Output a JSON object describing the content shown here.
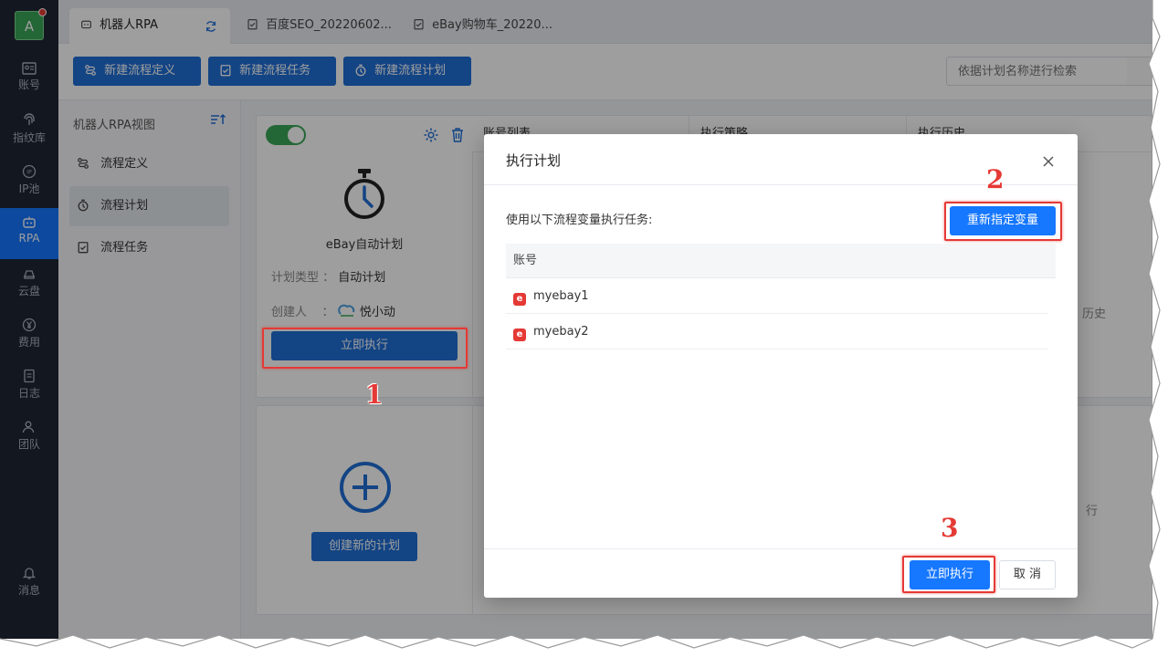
{
  "rail": {
    "avatar_letter": "A",
    "items": [
      {
        "label": "账号"
      },
      {
        "label": "指纹库"
      },
      {
        "label": "IP池"
      },
      {
        "label": "RPA"
      },
      {
        "label": "云盘"
      },
      {
        "label": "费用"
      },
      {
        "label": "日志"
      },
      {
        "label": "团队"
      },
      {
        "label": "消息"
      }
    ]
  },
  "tabs": [
    {
      "label": "机器人RPA"
    },
    {
      "label": "百度SEO_20220602..."
    },
    {
      "label": "eBay购物车_20220..."
    }
  ],
  "toolbar": {
    "new_definition": "新建流程定义",
    "new_task": "新建流程任务",
    "new_plan": "新建流程计划",
    "search_placeholder": "依据计划名称进行检索"
  },
  "nav": {
    "title": "机器人RPA视图",
    "items": [
      {
        "label": "流程定义"
      },
      {
        "label": "流程计划"
      },
      {
        "label": "流程任务"
      }
    ]
  },
  "plan_card": {
    "name": "eBay自动计划",
    "type_label": "计划类型",
    "type_value": "自动计划",
    "creator_label": "创建人",
    "creator_value": "悦小动",
    "run_now": "立即执行"
  },
  "columns": {
    "accounts": "账号列表",
    "strategy": "执行策略",
    "history": "执行历史",
    "history_fragment": "历史",
    "exec_fragment": "行"
  },
  "create_card": {
    "button": "创建新的计划"
  },
  "modal": {
    "title": "执行计划",
    "description": "使用以下流程变量执行任务:",
    "reassign_button": "重新指定变量",
    "table_header": "账号",
    "rows": [
      {
        "account": "myebay1"
      },
      {
        "account": "myebay2"
      }
    ],
    "execute_button": "立即执行",
    "cancel_button": "取 消"
  },
  "annotations": {
    "step1": "1",
    "step2": "2",
    "step3": "3"
  },
  "colors": {
    "primary": "#1677ff",
    "rail_bg": "#1f2633",
    "toggle_on": "#3aa757",
    "highlight": "#e53935"
  }
}
